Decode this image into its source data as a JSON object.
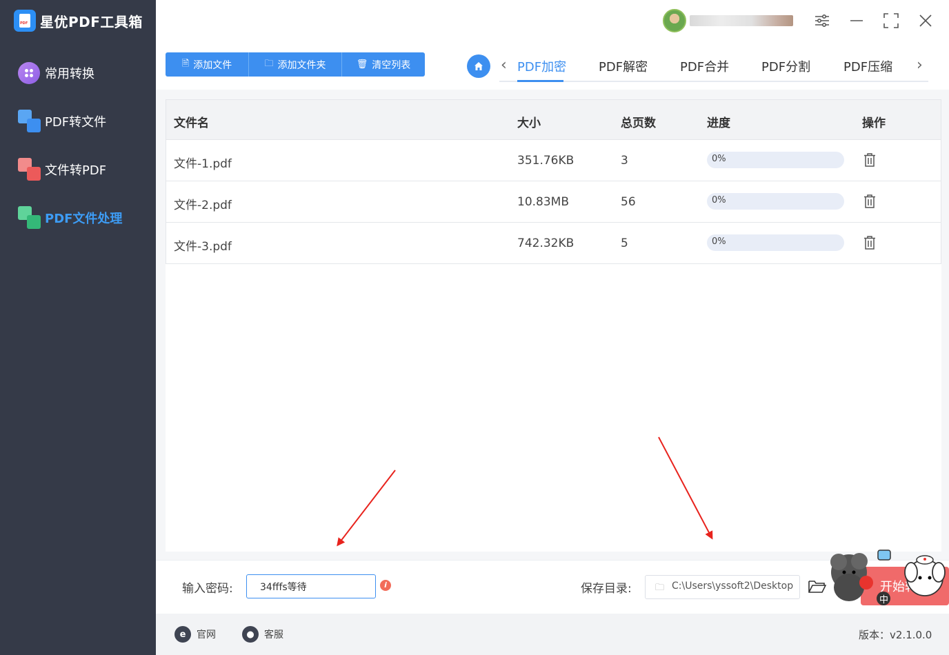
{
  "app": {
    "title": "星优PDF工具箱"
  },
  "sidebar": {
    "items": [
      {
        "label": "常用转换",
        "icon": "grid-circle-icon"
      },
      {
        "label": "PDF转文件",
        "icon": "pdf-to-file-icon"
      },
      {
        "label": "文件转PDF",
        "icon": "file-to-pdf-icon"
      },
      {
        "label": "PDF文件处理",
        "icon": "pdf-process-icon",
        "active": true
      }
    ]
  },
  "toolbar": {
    "add_file": "添加文件",
    "add_folder": "添加文件夹",
    "clear_list": "清空列表"
  },
  "tabs": {
    "items": [
      "PDF加密",
      "PDF解密",
      "PDF合并",
      "PDF分割",
      "PDF压缩"
    ],
    "active": "PDF加密"
  },
  "table": {
    "headers": {
      "name": "文件名",
      "size": "大小",
      "pages": "总页数",
      "progress": "进度",
      "action": "操作"
    },
    "rows": [
      {
        "name": "文件-1.pdf",
        "size": "351.76KB",
        "pages": "3",
        "progress": "0%",
        "progress_value": 0
      },
      {
        "name": "文件-2.pdf",
        "size": "10.83MB",
        "pages": "56",
        "progress": "0%",
        "progress_value": 0
      },
      {
        "name": "文件-3.pdf",
        "size": "742.32KB",
        "pages": "5",
        "progress": "0%",
        "progress_value": 0
      }
    ]
  },
  "settings": {
    "password_label": "输入密码:",
    "password_value": "34fffs等待",
    "save_dir_label": "保存目录:",
    "save_dir_value": "C:\\Users\\yssoft2\\Desktop",
    "start_label": "开始转换"
  },
  "footer": {
    "website": "官网",
    "support": "客服",
    "version": "版本：v2.1.0.0"
  },
  "colors": {
    "sidebar_bg": "#353a48",
    "accent": "#3d8ff0",
    "start_button": "#f06a6a",
    "annotation_arrow": "#e8231d"
  }
}
